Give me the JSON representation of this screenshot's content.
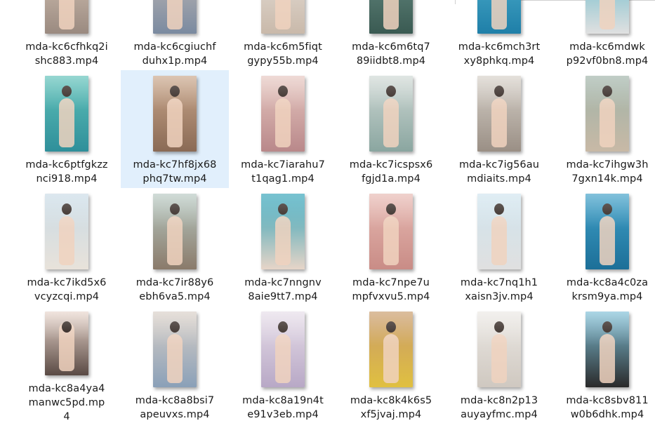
{
  "files": [
    {
      "line1": "mda-kc6cfhkq2i",
      "line2": "shc883.mp4",
      "line3": "",
      "colors": [
        "#d9c7b8",
        "#9a8a80"
      ]
    },
    {
      "line1": "mda-kc6cgiuchf",
      "line2": "duhx1p.mp4",
      "line3": "",
      "colors": [
        "#c8bdb6",
        "#7a8aa0"
      ]
    },
    {
      "line1": "mda-kc6m5fiqt",
      "line2": "gypy55b.mp4",
      "line3": "",
      "colors": [
        "#e8e2dc",
        "#c9b9aa"
      ]
    },
    {
      "line1": "mda-kc6m6tq7",
      "line2": "89iidbt8.mp4",
      "line3": "",
      "colors": [
        "#6a8f86",
        "#3a5a52"
      ]
    },
    {
      "line1": "mda-kc6mch3rt",
      "line2": "xy8phkq.mp4",
      "line3": "",
      "colors": [
        "#52b3d0",
        "#1f7fa8"
      ]
    },
    {
      "line1": "mda-kc6mdwk",
      "line2": "p92vf0bn8.mp4",
      "line3": "",
      "colors": [
        "#5cb6c8",
        "#e0e0e0"
      ]
    },
    {
      "line1": "mda-kc6ptfgkzz",
      "line2": "nci918.mp4",
      "line3": "",
      "colors": [
        "#5fc1b9",
        "#2f8f9a"
      ]
    },
    {
      "line1": "mda-kc7hf8jx68",
      "line2": "phq7tw.mp4",
      "line3": "",
      "colors": [
        "#c9a68a",
        "#8a6a55"
      ]
    },
    {
      "line1": "mda-kc7iarahu7",
      "line2": "t1qag1.mp4",
      "line3": "",
      "colors": [
        "#e6c7c0",
        "#b9888a"
      ]
    },
    {
      "line1": "mda-kc7icspsx6",
      "line2": "fgjd1a.mp4",
      "line3": "",
      "colors": [
        "#cfd8d4",
        "#8aa6a0"
      ]
    },
    {
      "line1": "mda-kc7ig56au",
      "line2": "mdiaits.mp4",
      "line3": "",
      "colors": [
        "#d6d0c8",
        "#9a8f85"
      ]
    },
    {
      "line1": "mda-kc7ihgw3h",
      "line2": "7gxn14k.mp4",
      "line3": "",
      "colors": [
        "#9fb3a8",
        "#c8b9a6"
      ]
    },
    {
      "line1": "mda-kc7ikd5x6",
      "line2": "vcyzcqi.mp4",
      "line3": "",
      "colors": [
        "#c9dbe6",
        "#e8e2da"
      ]
    },
    {
      "line1": "mda-kc7ir88y6",
      "line2": "ebh6va5.mp4",
      "line3": "",
      "colors": [
        "#b7c9c2",
        "#8a7a6a"
      ]
    },
    {
      "line1": "mda-kc7nngnv",
      "line2": "8aie9tt7.mp4",
      "line3": "",
      "colors": [
        "#2fa2b8",
        "#e7d5c8"
      ]
    },
    {
      "line1": "mda-kc7npe7u",
      "line2": "mpfvxvu5.mp4",
      "line3": "",
      "colors": [
        "#e7b9b2",
        "#c98c86"
      ]
    },
    {
      "line1": "mda-kc7nq1h1",
      "line2": "xaisn3jv.mp4",
      "line3": "",
      "colors": [
        "#cfe4ee",
        "#e0e0e0"
      ]
    },
    {
      "line1": "mda-kc8a4c0za",
      "line2": "krsm9ya.mp4",
      "line3": "",
      "colors": [
        "#3fa0c8",
        "#1c6f98"
      ]
    },
    {
      "line1": "mda-kc8a4ya4",
      "line2": "manwc5pd.mp",
      "line3": "4",
      "colors": [
        "#e8d6cc",
        "#5a4a44"
      ]
    },
    {
      "line1": "mda-kc8a8bsi7",
      "line2": "apeuvxs.mp4",
      "line3": "",
      "colors": [
        "#d9cfc6",
        "#8aa0b8"
      ]
    },
    {
      "line1": "mda-kc8a19n4t",
      "line2": "e91v3eb.mp4",
      "line3": "",
      "colors": [
        "#e6dde8",
        "#b8a8c6"
      ]
    },
    {
      "line1": "mda-kc8k4k6s5",
      "line2": "xf5jvaj.mp4",
      "line3": "",
      "colors": [
        "#c89a6a",
        "#e0c040"
      ]
    },
    {
      "line1": "mda-kc8n2p13",
      "line2": "auyayfmc.mp4",
      "line3": "",
      "colors": [
        "#ebe8e4",
        "#cfc8c0"
      ]
    },
    {
      "line1": "mda-kc8sbv811",
      "line2": "w0b6dhk.mp4",
      "line3": "",
      "colors": [
        "#7fc0d8",
        "#2a2a2a"
      ]
    }
  ],
  "selected_index": 7
}
